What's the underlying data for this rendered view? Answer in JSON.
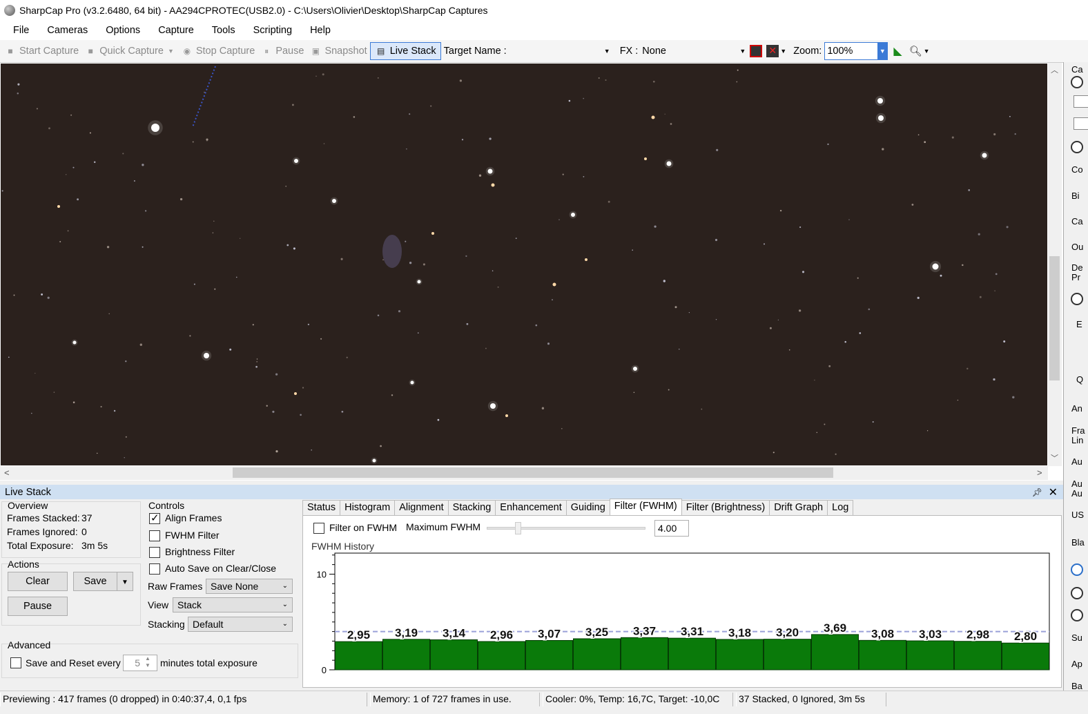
{
  "window": {
    "title": "SharpCap Pro (v3.2.6480, 64 bit) - AA294CPROTEC(USB2.0) - C:\\Users\\Olivier\\Desktop\\SharpCap Captures"
  },
  "menu": [
    "File",
    "Cameras",
    "Options",
    "Capture",
    "Tools",
    "Scripting",
    "Help"
  ],
  "toolbar": {
    "start_capture": "Start Capture",
    "quick_capture": "Quick Capture",
    "stop_capture": "Stop Capture",
    "pause": "Pause",
    "snapshot": "Snapshot",
    "live_stack": "Live Stack",
    "target_name_label": "Target Name :",
    "target_name_value": "",
    "fx_label": "FX :",
    "fx_value": "None",
    "zoom_label": "Zoom:",
    "zoom_value": "100%"
  },
  "right_panel": {
    "labels": [
      "Ca",
      "Co",
      "Bi",
      "Ca",
      "Ou",
      "De",
      "Pr",
      "E",
      "Q",
      "An",
      "Fra",
      "Lin",
      "Au",
      "Au",
      "Au",
      "US",
      "Bla",
      "Su",
      "Ap",
      "Ba"
    ]
  },
  "live_stack": {
    "title": "Live Stack",
    "overview": {
      "label": "Overview",
      "frames_stacked_label": "Frames Stacked:",
      "frames_stacked": "37",
      "frames_ignored_label": "Frames Ignored:",
      "frames_ignored": "0",
      "total_exposure_label": "Total Exposure:",
      "total_exposure": "3m 5s"
    },
    "actions": {
      "label": "Actions",
      "clear": "Clear",
      "save": "Save",
      "pause": "Pause"
    },
    "advanced": {
      "label": "Advanced",
      "save_reset_label": "Save and Reset every",
      "save_reset_checked": false,
      "minutes_value": "5",
      "minutes_suffix": "minutes total exposure"
    },
    "controls": {
      "label": "Controls",
      "align_frames": "Align Frames",
      "align_frames_checked": true,
      "fwhm_filter": "FWHM Filter",
      "fwhm_filter_checked": false,
      "brightness_filter": "Brightness Filter",
      "brightness_filter_checked": false,
      "auto_save": "Auto Save on Clear/Close",
      "auto_save_checked": false,
      "raw_frames_label": "Raw Frames",
      "raw_frames_value": "Save None",
      "view_label": "View",
      "view_value": "Stack",
      "stacking_label": "Stacking",
      "stacking_value": "Default"
    },
    "tabs": [
      "Status",
      "Histogram",
      "Alignment",
      "Stacking",
      "Enhancement",
      "Guiding",
      "Filter (FWHM)",
      "Filter (Brightness)",
      "Drift Graph",
      "Log"
    ],
    "active_tab": "Filter (FWHM)",
    "fwhm": {
      "filter_on_label": "Filter on FWHM",
      "filter_on_checked": false,
      "max_label": "Maximum FWHM",
      "max_value": "4.00",
      "history_label": "FWHM History"
    }
  },
  "chart_data": {
    "type": "bar",
    "title": "",
    "xlabel": "",
    "ylabel": "",
    "ylim": [
      0,
      12.2
    ],
    "yticks": [
      0,
      10
    ],
    "ytick_labels": [
      "0",
      "10"
    ],
    "values": [
      2.95,
      3.19,
      3.14,
      2.96,
      3.07,
      3.25,
      3.37,
      3.31,
      3.18,
      3.2,
      3.69,
      3.08,
      3.03,
      2.98,
      2.8
    ],
    "value_labels": [
      "2,95",
      "3,19",
      "3,14",
      "2,96",
      "3,07",
      "3,25",
      "3,37",
      "3,31",
      "3,18",
      "3,20",
      "3,69",
      "3,08",
      "3,03",
      "2,98",
      "2,80"
    ],
    "threshold": 4.0,
    "bar_color": "#0a7a0a",
    "threshold_color": "#9aa0d8"
  },
  "status_bar": {
    "preview": "Previewing : 417 frames (0 dropped) in 0:40:37,4, 0,1 fps",
    "memory": "Memory: 1 of 727 frames in use.",
    "cooler": "Cooler: 0%, Temp: 16,7C, Target: -10,0C",
    "stack": "37 Stacked, 0 Ignored, 3m 5s"
  },
  "colors": {
    "sky": "#2b211d",
    "accent": "#3b7ad6",
    "panel_header": "#cfe0f2"
  }
}
